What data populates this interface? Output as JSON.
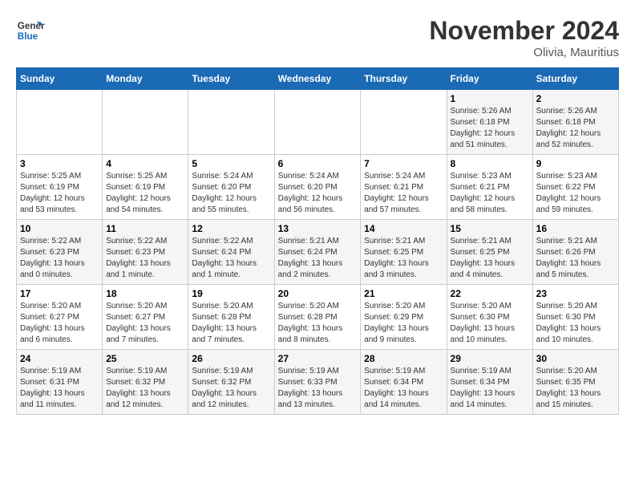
{
  "logo": {
    "line1": "General",
    "line2": "Blue"
  },
  "title": "November 2024",
  "location": "Olivia, Mauritius",
  "weekdays": [
    "Sunday",
    "Monday",
    "Tuesday",
    "Wednesday",
    "Thursday",
    "Friday",
    "Saturday"
  ],
  "weeks": [
    [
      {
        "day": "",
        "info": ""
      },
      {
        "day": "",
        "info": ""
      },
      {
        "day": "",
        "info": ""
      },
      {
        "day": "",
        "info": ""
      },
      {
        "day": "",
        "info": ""
      },
      {
        "day": "1",
        "info": "Sunrise: 5:26 AM\nSunset: 6:18 PM\nDaylight: 12 hours\nand 51 minutes."
      },
      {
        "day": "2",
        "info": "Sunrise: 5:26 AM\nSunset: 6:18 PM\nDaylight: 12 hours\nand 52 minutes."
      }
    ],
    [
      {
        "day": "3",
        "info": "Sunrise: 5:25 AM\nSunset: 6:19 PM\nDaylight: 12 hours\nand 53 minutes."
      },
      {
        "day": "4",
        "info": "Sunrise: 5:25 AM\nSunset: 6:19 PM\nDaylight: 12 hours\nand 54 minutes."
      },
      {
        "day": "5",
        "info": "Sunrise: 5:24 AM\nSunset: 6:20 PM\nDaylight: 12 hours\nand 55 minutes."
      },
      {
        "day": "6",
        "info": "Sunrise: 5:24 AM\nSunset: 6:20 PM\nDaylight: 12 hours\nand 56 minutes."
      },
      {
        "day": "7",
        "info": "Sunrise: 5:24 AM\nSunset: 6:21 PM\nDaylight: 12 hours\nand 57 minutes."
      },
      {
        "day": "8",
        "info": "Sunrise: 5:23 AM\nSunset: 6:21 PM\nDaylight: 12 hours\nand 58 minutes."
      },
      {
        "day": "9",
        "info": "Sunrise: 5:23 AM\nSunset: 6:22 PM\nDaylight: 12 hours\nand 59 minutes."
      }
    ],
    [
      {
        "day": "10",
        "info": "Sunrise: 5:22 AM\nSunset: 6:23 PM\nDaylight: 13 hours\nand 0 minutes."
      },
      {
        "day": "11",
        "info": "Sunrise: 5:22 AM\nSunset: 6:23 PM\nDaylight: 13 hours\nand 1 minute."
      },
      {
        "day": "12",
        "info": "Sunrise: 5:22 AM\nSunset: 6:24 PM\nDaylight: 13 hours\nand 1 minute."
      },
      {
        "day": "13",
        "info": "Sunrise: 5:21 AM\nSunset: 6:24 PM\nDaylight: 13 hours\nand 2 minutes."
      },
      {
        "day": "14",
        "info": "Sunrise: 5:21 AM\nSunset: 6:25 PM\nDaylight: 13 hours\nand 3 minutes."
      },
      {
        "day": "15",
        "info": "Sunrise: 5:21 AM\nSunset: 6:25 PM\nDaylight: 13 hours\nand 4 minutes."
      },
      {
        "day": "16",
        "info": "Sunrise: 5:21 AM\nSunset: 6:26 PM\nDaylight: 13 hours\nand 5 minutes."
      }
    ],
    [
      {
        "day": "17",
        "info": "Sunrise: 5:20 AM\nSunset: 6:27 PM\nDaylight: 13 hours\nand 6 minutes."
      },
      {
        "day": "18",
        "info": "Sunrise: 5:20 AM\nSunset: 6:27 PM\nDaylight: 13 hours\nand 7 minutes."
      },
      {
        "day": "19",
        "info": "Sunrise: 5:20 AM\nSunset: 6:28 PM\nDaylight: 13 hours\nand 7 minutes."
      },
      {
        "day": "20",
        "info": "Sunrise: 5:20 AM\nSunset: 6:28 PM\nDaylight: 13 hours\nand 8 minutes."
      },
      {
        "day": "21",
        "info": "Sunrise: 5:20 AM\nSunset: 6:29 PM\nDaylight: 13 hours\nand 9 minutes."
      },
      {
        "day": "22",
        "info": "Sunrise: 5:20 AM\nSunset: 6:30 PM\nDaylight: 13 hours\nand 10 minutes."
      },
      {
        "day": "23",
        "info": "Sunrise: 5:20 AM\nSunset: 6:30 PM\nDaylight: 13 hours\nand 10 minutes."
      }
    ],
    [
      {
        "day": "24",
        "info": "Sunrise: 5:19 AM\nSunset: 6:31 PM\nDaylight: 13 hours\nand 11 minutes."
      },
      {
        "day": "25",
        "info": "Sunrise: 5:19 AM\nSunset: 6:32 PM\nDaylight: 13 hours\nand 12 minutes."
      },
      {
        "day": "26",
        "info": "Sunrise: 5:19 AM\nSunset: 6:32 PM\nDaylight: 13 hours\nand 12 minutes."
      },
      {
        "day": "27",
        "info": "Sunrise: 5:19 AM\nSunset: 6:33 PM\nDaylight: 13 hours\nand 13 minutes."
      },
      {
        "day": "28",
        "info": "Sunrise: 5:19 AM\nSunset: 6:34 PM\nDaylight: 13 hours\nand 14 minutes."
      },
      {
        "day": "29",
        "info": "Sunrise: 5:19 AM\nSunset: 6:34 PM\nDaylight: 13 hours\nand 14 minutes."
      },
      {
        "day": "30",
        "info": "Sunrise: 5:20 AM\nSunset: 6:35 PM\nDaylight: 13 hours\nand 15 minutes."
      }
    ]
  ]
}
